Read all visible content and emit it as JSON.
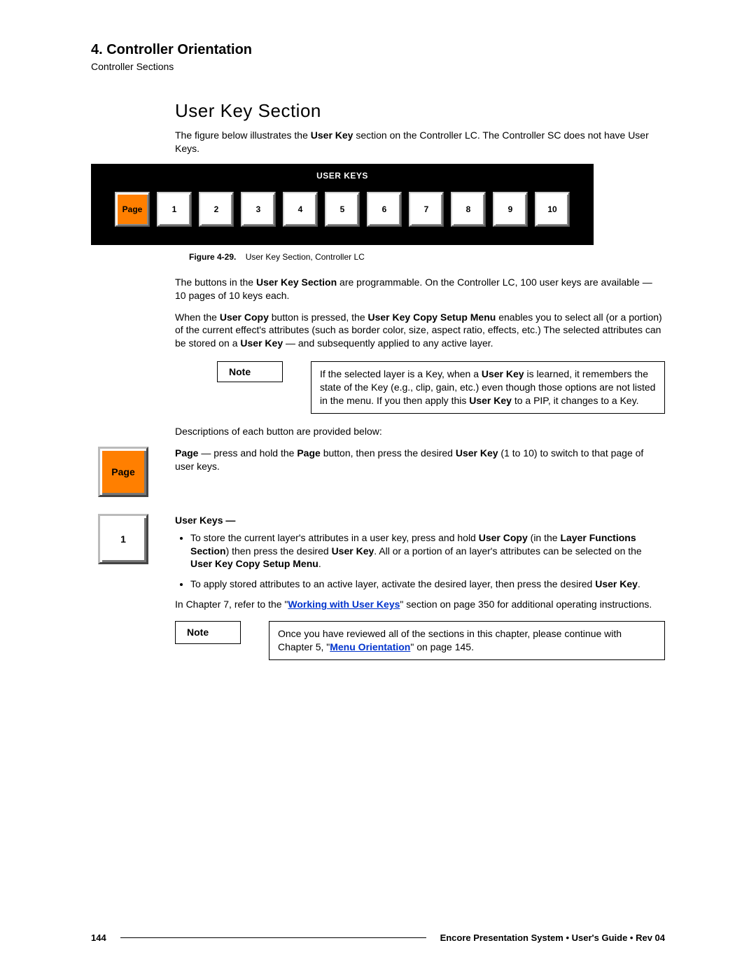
{
  "header": {
    "chapter": "4.  Controller Orientation",
    "subtitle": "Controller Sections"
  },
  "section": {
    "heading": "User Key Section",
    "intro_a": "The figure below illustrates the ",
    "intro_b": "User Key",
    "intro_c": " section on the Controller LC.  The Controller SC does not have User Keys."
  },
  "panel": {
    "title": "USER KEYS",
    "page_label": "Page",
    "keys": [
      "1",
      "2",
      "3",
      "4",
      "5",
      "6",
      "7",
      "8",
      "9",
      "10"
    ]
  },
  "figure": {
    "label": "Figure 4-29.",
    "caption": "User Key Section, Controller LC"
  },
  "p2": {
    "a": "The buttons in the ",
    "b": "User Key Section",
    "c": " are programmable.  On the Controller LC, 100 user keys are available — 10 pages of 10 keys each."
  },
  "p3": {
    "a": "When the ",
    "b": "User Copy",
    "c": " button is pressed, the ",
    "d": "User Key Copy Setup Menu",
    "e": " enables you to select all (or a portion) of the current effect's attributes (such as border color, size, aspect ratio, effects, etc.)  The selected attributes can be stored on a ",
    "f": "User Key",
    "g": " — and subsequently applied to any active layer."
  },
  "note1": {
    "label": "Note",
    "a": "If the selected layer is a Key, when a ",
    "b": "User Key",
    "c": " is learned, it remembers the state of the Key (e.g., clip, gain, etc.) even though those options are not listed in the menu.  If you then apply this ",
    "d": "User Key",
    "e": " to a PIP, it changes to a Key."
  },
  "p4": "Descriptions of each button are provided below:",
  "page_desc": {
    "key_label": "Page",
    "a": "Page",
    "b": " — press and hold the ",
    "c": "Page",
    "d": " button, then press the desired ",
    "e": "User Key",
    "f": " (1 to 10) to switch to that page of user keys."
  },
  "userkeys_desc": {
    "key_label": "1",
    "title": "User Keys —",
    "b1_a": "To store the current layer's attributes in a user key, press and hold ",
    "b1_b": "User Copy",
    "b1_c": " (in the ",
    "b1_d": "Layer Functions Section",
    "b1_e": ") then press the desired ",
    "b1_f": "User Key",
    "b1_g": ".  All or a portion of an layer's attributes can be selected on the ",
    "b1_h": "User Key Copy Setup Menu",
    "b1_i": ".",
    "b2_a": "To apply stored attributes to an active layer, activate the desired layer, then press the desired ",
    "b2_b": "User Key",
    "b2_c": "."
  },
  "p5": {
    "a": "In Chapter 7, refer to the \"",
    "link": "Working with User Keys",
    "b": "\" section on page 350 for additional operating instructions."
  },
  "note2": {
    "label": "Note",
    "a": "Once you have reviewed all of the sections in this chapter, please continue with Chapter 5, \"",
    "link": "Menu Orientation",
    "b": "\" on page 145."
  },
  "footer": {
    "page": "144",
    "text": "Encore Presentation System  •  User's Guide  •  Rev 04"
  }
}
